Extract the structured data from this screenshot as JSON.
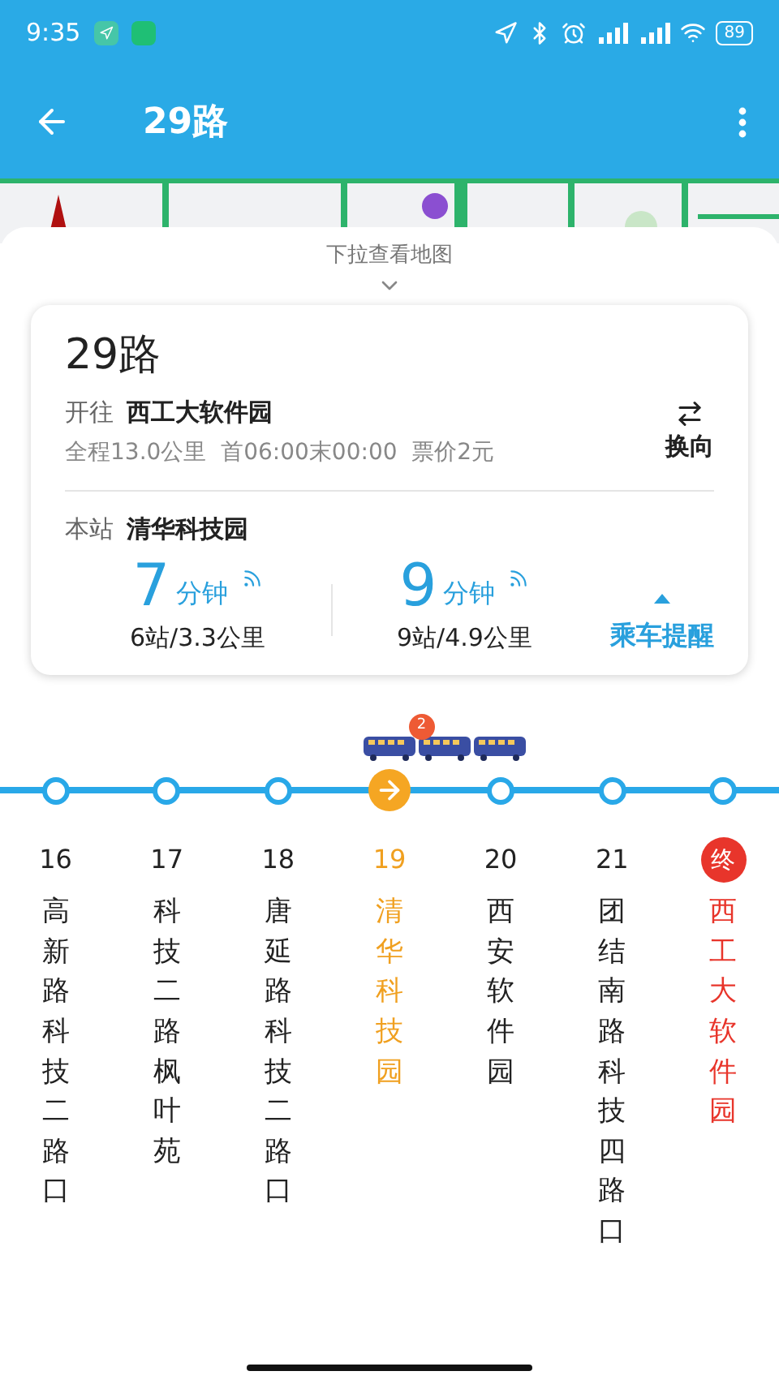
{
  "status_bar": {
    "time": "9:35",
    "battery": "89"
  },
  "app_bar": {
    "title": "29路"
  },
  "sheet": {
    "pull_hint": "下拉查看地图"
  },
  "route_card": {
    "name": "29路",
    "direction_label": "开往",
    "destination": "西工大软件园",
    "info": "全程13.0公里  首06:00末00:00  票价2元",
    "switch_label": "换向",
    "station_label": "本站",
    "station": "清华科技园",
    "arrivals": [
      {
        "minutes": "7",
        "unit": "分钟",
        "distance": "6站/3.3公里"
      },
      {
        "minutes": "9",
        "unit": "分钟",
        "distance": "9站/4.9公里"
      }
    ],
    "reminder_label": "乘车提醒"
  },
  "bus_group": {
    "count": "2"
  },
  "stops": [
    {
      "number": "16",
      "name": "高新路科技二路口",
      "kind": "normal"
    },
    {
      "number": "17",
      "name": "科技二路枫叶苑",
      "kind": "normal"
    },
    {
      "number": "18",
      "name": "唐延路科技二路口",
      "kind": "normal"
    },
    {
      "number": "19",
      "name": "清华科技园",
      "kind": "current"
    },
    {
      "number": "20",
      "name": "西安软件园",
      "kind": "normal"
    },
    {
      "number": "21",
      "name": "团结南路科技四路口",
      "kind": "normal"
    },
    {
      "number": "终",
      "name": "西工大软件园",
      "kind": "terminal"
    }
  ]
}
